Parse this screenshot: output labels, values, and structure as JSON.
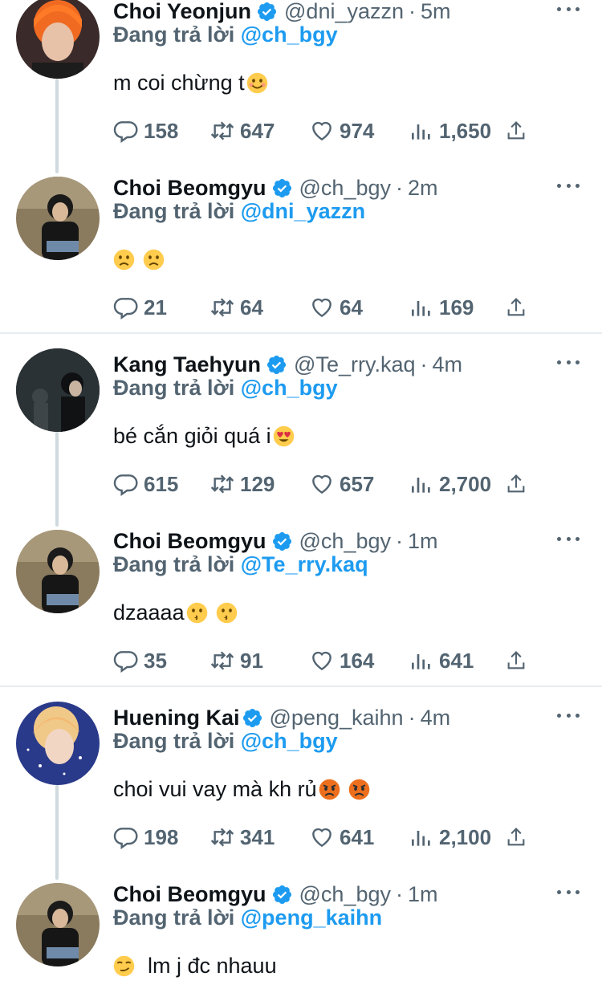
{
  "tweets": [
    {
      "name": "Choi Yeonjun",
      "handle": "@dni_yazzn",
      "time": "5m",
      "replying_prefix": "Đang trả lời",
      "replying_to": "@ch_bgy",
      "text": "m coi chừng t",
      "emoji": [
        "smiling-face"
      ],
      "stats": {
        "replies": "158",
        "retweets": "647",
        "likes": "974",
        "views": "1,650"
      }
    },
    {
      "name": "Choi Beomgyu",
      "handle": "@ch_bgy",
      "time": "2m",
      "replying_prefix": "Đang trả lời",
      "replying_to": "@dni_yazzn",
      "text": "",
      "emoji": [
        "frowning-face",
        "frowning-face"
      ],
      "stats": {
        "replies": "21",
        "retweets": "64",
        "likes": "64",
        "views": "169"
      }
    },
    {
      "name": "Kang Taehyun",
      "handle": "@Te_rry.kaq",
      "time": "4m",
      "replying_prefix": "Đang trả lời",
      "replying_to": "@ch_bgy",
      "text": "bé cắn giỏi quá i",
      "emoji": [
        "heart-eyes-face"
      ],
      "stats": {
        "replies": "615",
        "retweets": "129",
        "likes": "657",
        "views": "2,700"
      }
    },
    {
      "name": "Choi Beomgyu",
      "handle": "@ch_bgy",
      "time": "1m",
      "replying_prefix": "Đang trả lời",
      "replying_to": "@Te_rry.kaq",
      "text": "dzaaaa",
      "emoji": [
        "kissing-face",
        "kissing-face"
      ],
      "stats": {
        "replies": "35",
        "retweets": "91",
        "likes": "164",
        "views": "641"
      }
    },
    {
      "name": "Huening Kai",
      "handle": "@peng_kaihn",
      "time": "4m",
      "replying_prefix": "Đang trả lời",
      "replying_to": "@ch_bgy",
      "text": "choi vui vay mà kh rủ",
      "emoji": [
        "pouting-face",
        "pouting-face"
      ],
      "stats": {
        "replies": "198",
        "retweets": "341",
        "likes": "641",
        "views": "2,100"
      }
    },
    {
      "name": "Choi Beomgyu",
      "handle": "@ch_bgy",
      "time": "1m",
      "replying_prefix": "Đang trả lời",
      "replying_to": "@peng_kaihn",
      "text": "lm j đc nhauu",
      "emoji": [
        "smirking-face"
      ],
      "stats": null
    }
  ],
  "colors": {
    "accent": "#1d9bf0",
    "secondary_text": "#536471",
    "thread_line": "#cfd9de"
  }
}
